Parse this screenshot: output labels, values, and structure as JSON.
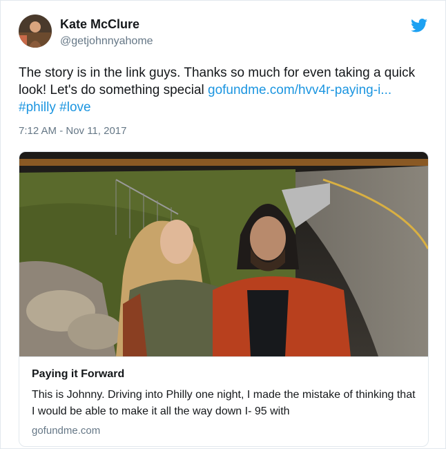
{
  "author": {
    "name": "Kate McClure",
    "handle": "@getjohnnyahome"
  },
  "icons": {
    "avatar": "user-avatar-photo",
    "brand": "twitter-bird-icon"
  },
  "tweet": {
    "text_prefix": "The story is in the link guys. Thanks so much for even taking a quick look! Let's do something special ",
    "link_text": "gofundme.com/hvv4r-paying-i...",
    "hashtags": [
      "#philly",
      "#love"
    ],
    "timestamp": "7:12 AM - Nov 11, 2017"
  },
  "card": {
    "title": "Paying it Forward",
    "description": "This is Johnny. Driving into Philly one night, I made the mistake of thinking that I would be able to make it all the way down I- 95 with",
    "domain": "gofundme.com"
  },
  "colors": {
    "link": "#1b95e0",
    "secondary_text": "#657786",
    "border": "#e1e8ed"
  }
}
